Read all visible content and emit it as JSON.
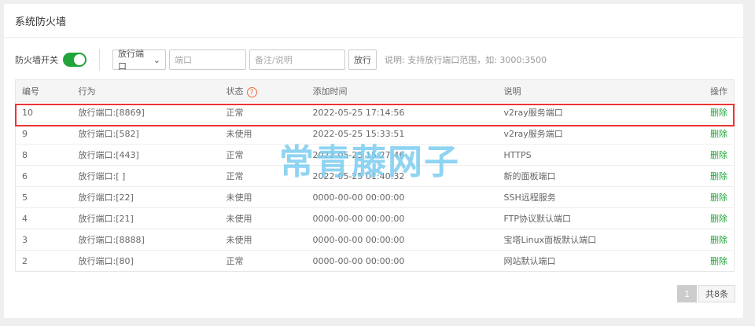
{
  "title": "系统防火墙",
  "toolbar": {
    "switch_label": "防火墙开关",
    "switch_on": true,
    "select_value": "放行端口",
    "port_placeholder": "端口",
    "note_placeholder": "备注/说明",
    "submit": "放行",
    "hint": "说明: 支持放行端口范围，如: 3000:3500"
  },
  "table": {
    "headers": [
      "编号",
      "行为",
      "状态",
      "添加时间",
      "说明",
      "操作"
    ],
    "rows": [
      [
        "10",
        "放行端口:[8869]",
        "正常",
        "2022-05-25 17:14:56",
        "v2ray服务端口",
        "删除"
      ],
      [
        "9",
        "放行端口:[582]",
        "未使用",
        "2022-05-25 15:33:51",
        "v2ray服务端口",
        "删除"
      ],
      [
        "8",
        "放行端口:[443]",
        "正常",
        "2022-05-25 15:27:46",
        "HTTPS",
        "删除"
      ],
      [
        "6",
        "放行端口:[    ]",
        "正常",
        "2022-05-25 01:40:32",
        "新的面板端口",
        "删除"
      ],
      [
        "5",
        "放行端口:[22]",
        "未使用",
        "0000-00-00 00:00:00",
        "SSH远程服务",
        "删除"
      ],
      [
        "4",
        "放行端口:[21]",
        "未使用",
        "0000-00-00 00:00:00",
        "FTP协议默认端口",
        "删除"
      ],
      [
        "3",
        "放行端口:[8888]",
        "未使用",
        "0000-00-00 00:00:00",
        "宝塔Linux面板默认端口",
        "删除"
      ],
      [
        "2",
        "放行端口:[80]",
        "正常",
        "0000-00-00 00:00:00",
        "网站默认端口",
        "删除"
      ]
    ]
  },
  "pager": {
    "current": "1",
    "total": "共8条"
  },
  "watermark": "常青藤网子",
  "colors": {
    "accent": "#20a53a",
    "highlight": "#ee3333"
  }
}
